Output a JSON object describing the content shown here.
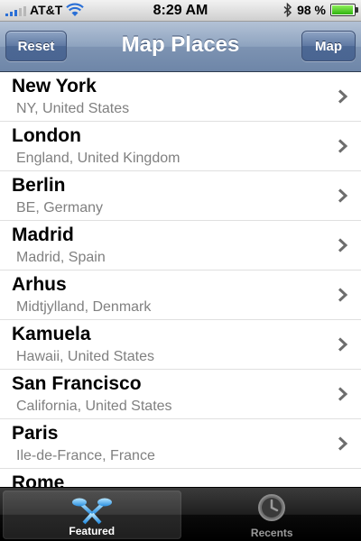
{
  "status_bar": {
    "carrier": "AT&T",
    "time": "8:29 AM",
    "battery_text": "98 %",
    "battery_level": 0.98
  },
  "nav": {
    "title": "Map Places",
    "left_button": "Reset",
    "right_button": "Map"
  },
  "places": [
    {
      "name": "New York",
      "region": "NY, United States"
    },
    {
      "name": "London",
      "region": "England, United Kingdom"
    },
    {
      "name": "Berlin",
      "region": "BE, Germany"
    },
    {
      "name": "Madrid",
      "region": "Madrid, Spain"
    },
    {
      "name": "Arhus",
      "region": "Midtjylland, Denmark"
    },
    {
      "name": "Kamuela",
      "region": "Hawaii, United States"
    },
    {
      "name": "San Francisco",
      "region": "California, United States"
    },
    {
      "name": "Paris",
      "region": "Ile-de-France, France"
    },
    {
      "name": "Rome",
      "region": ""
    }
  ],
  "tabs": [
    {
      "label": "Featured",
      "icon": "featured-icon",
      "active": true
    },
    {
      "label": "Recents",
      "icon": "clock-icon",
      "active": false
    }
  ],
  "colors": {
    "nav_bar": "#8ea3bf",
    "subtitle_gray": "#808080",
    "tab_bar": "#000000",
    "active_tab_icon": "#4fb8f5"
  }
}
